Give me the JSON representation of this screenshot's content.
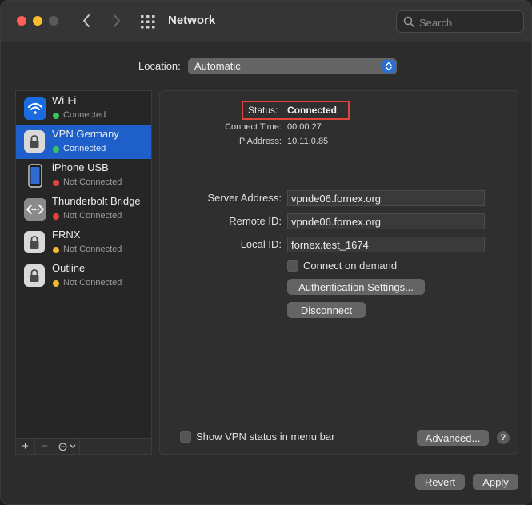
{
  "window": {
    "title": "Network"
  },
  "search": {
    "placeholder": "Search"
  },
  "location": {
    "label": "Location:",
    "value": "Automatic"
  },
  "services": [
    {
      "name": "Wi-Fi",
      "status": "Connected",
      "status_color": "#35c759",
      "icon": "wifi-icon"
    },
    {
      "name": "VPN Germany",
      "status": "Connected",
      "status_color": "#35c759",
      "icon": "lock-icon",
      "selected": true
    },
    {
      "name": "iPhone USB",
      "status": "Not Connected",
      "status_color": "#e0443a",
      "icon": "iphone-icon"
    },
    {
      "name": "Thunderbolt Bridge",
      "status": "Not Connected",
      "status_color": "#e0443a",
      "icon": "thunderbolt-bridge-icon"
    },
    {
      "name": "FRNX",
      "status": "Not Connected",
      "status_color": "#f5b82e",
      "icon": "lock-icon"
    },
    {
      "name": "Outline",
      "status": "Not Connected",
      "status_color": "#f5b82e",
      "icon": "lock-icon"
    }
  ],
  "sidebar_footer": {
    "add": "+",
    "remove": "−",
    "action": "⊝"
  },
  "detail": {
    "status_label": "Status:",
    "status_value": "Connected",
    "connect_time_label": "Connect Time:",
    "connect_time_value": "00:00:27",
    "ip_label": "IP Address:",
    "ip_value": "10.11.0.85",
    "server_label": "Server Address:",
    "server_value": "vpnde06.fornex.org",
    "remote_label": "Remote ID:",
    "remote_value": "vpnde06.fornex.org",
    "local_label": "Local ID:",
    "local_value": "fornex.test_1674",
    "connect_on_demand": "Connect on demand",
    "auth_button": "Authentication Settings...",
    "disconnect_button": "Disconnect",
    "show_vpn_status": "Show VPN status in menu bar",
    "advanced_button": "Advanced...",
    "help": "?"
  },
  "footer": {
    "revert": "Revert",
    "apply": "Apply"
  }
}
